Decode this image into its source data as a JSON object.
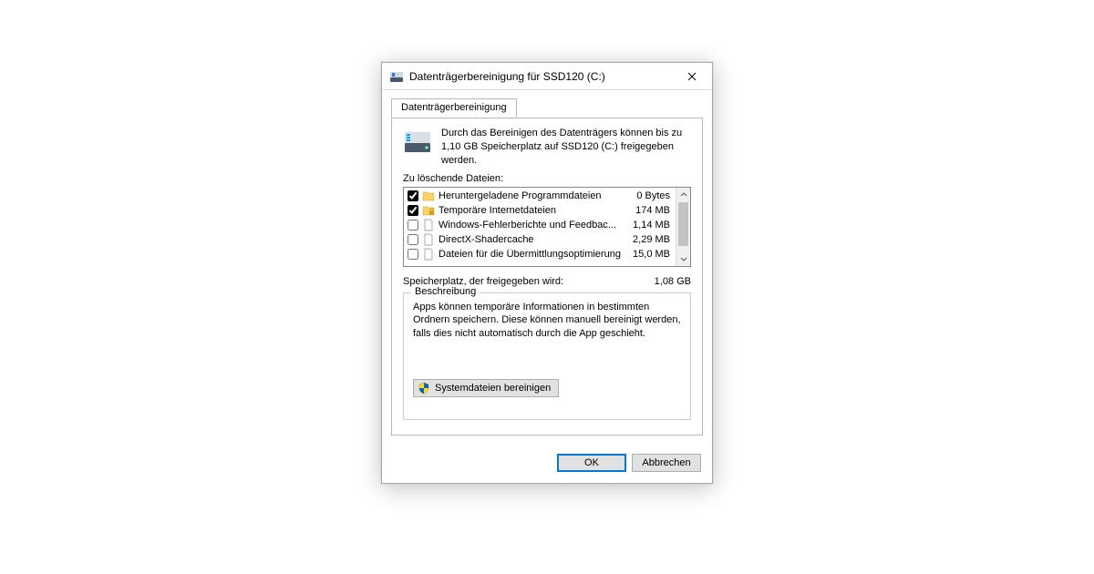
{
  "title": "Datenträgerbereinigung für SSD120 (C:)",
  "tab": {
    "label": "Datenträgerbereinigung"
  },
  "intro": "Durch das Bereinigen des Datenträgers können bis zu 1,10 GB Speicherplatz auf SSD120 (C:) freigegeben werden.",
  "list_label": "Zu löschende Dateien:",
  "files": [
    {
      "checked": true,
      "icon": "folder",
      "name": "Heruntergeladene Programmdateien",
      "size": "0 Bytes"
    },
    {
      "checked": true,
      "icon": "lock",
      "name": "Temporäre Internetdateien",
      "size": "174 MB"
    },
    {
      "checked": false,
      "icon": "file",
      "name": "Windows-Fehlerberichte und Feedbac...",
      "size": "1,14 MB"
    },
    {
      "checked": false,
      "icon": "file",
      "name": "DirectX-Shadercache",
      "size": "2,29 MB"
    },
    {
      "checked": false,
      "icon": "file",
      "name": "Dateien für die Übermittlungsoptimierung",
      "size": "15,0 MB"
    }
  ],
  "freed_label": "Speicherplatz, der freigegeben wird:",
  "freed_value": "1,08 GB",
  "groupbox_title": "Beschreibung",
  "description": "Apps können temporäre Informationen in bestimmten Ordnern speichern. Diese können manuell bereinigt werden, falls dies nicht automatisch durch die App geschieht.",
  "sys_button": "Systemdateien bereinigen",
  "ok_label": "OK",
  "cancel_label": "Abbrechen"
}
